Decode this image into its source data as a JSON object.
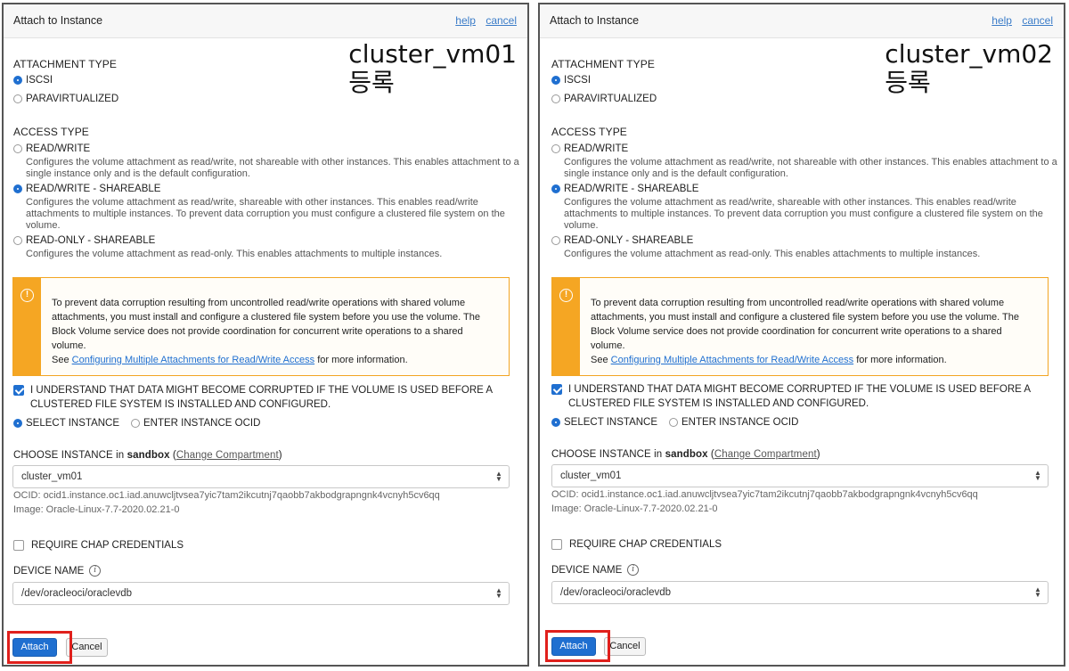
{
  "dialog_title": "Attach to Instance",
  "help_link": "help",
  "cancel_link": "cancel",
  "attachment_type_heading": "ATTACHMENT TYPE",
  "attachment_types": [
    "ISCSI",
    "PARAVIRTUALIZED"
  ],
  "access_type_heading": "ACCESS TYPE",
  "access_rw_label": "READ/WRITE",
  "access_rw_desc": "Configures the volume attachment as read/write, not shareable with other instances. This enables attachment to a single instance only and is the default configuration.",
  "access_rws_label": "READ/WRITE - SHAREABLE",
  "access_rws_desc": "Configures the volume attachment as read/write, shareable with other instances. This enables read/write attachments to multiple instances. To prevent data corruption you must configure a clustered file system on the volume.",
  "access_ros_label": "READ-ONLY - SHAREABLE",
  "access_ros_desc": "Configures the volume attachment as read-only. This enables attachments to multiple instances.",
  "warning_text": "To prevent data corruption resulting from uncontrolled read/write operations with shared volume attachments, you must install and configure a clustered file system before you use the volume. The Block Volume service does not provide coordination for concurrent write operations to a shared volume.",
  "warning_see": "See",
  "warning_link": "Configuring Multiple Attachments for Read/Write Access",
  "warning_more": "for more information.",
  "understand_label": "I UNDERSTAND THAT DATA MIGHT BECOME CORRUPTED IF THE VOLUME IS USED BEFORE A CLUSTERED FILE SYSTEM IS INSTALLED AND CONFIGURED.",
  "select_instance_label": "SELECT INSTANCE",
  "enter_ocid_label": "ENTER INSTANCE OCID",
  "choose_instance_prefix": "CHOOSE INSTANCE in",
  "compartment_name": "sandbox",
  "change_compartment": "Change Compartment",
  "instance_value": "cluster_vm01",
  "ocid_text": "OCID: ocid1.instance.oc1.iad.anuwcljtvsea7yic7tam2ikcutnj7qaobb7akbodgrapngnk4vcnyh5cv6qq",
  "image_text": "Image: Oracle-Linux-7.7-2020.02.21-0",
  "chap_label": "REQUIRE CHAP CREDENTIALS",
  "device_name_label": "DEVICE NAME",
  "device_name_value": "/dev/oracleoci/oraclevdb",
  "attach_button": "Attach",
  "cancel_button": "Cancel",
  "panels": [
    {
      "annotation_name": "cluster_vm01",
      "annotation_suffix": "등록"
    },
    {
      "annotation_name": "cluster_vm02",
      "annotation_suffix": "등록"
    }
  ],
  "colors": {
    "accent": "#1f6fd0",
    "warning": "#f5a623",
    "highlight": "#e0201c"
  },
  "icons": [
    "warning-icon",
    "info-icon",
    "chevron-updown-icon"
  ]
}
